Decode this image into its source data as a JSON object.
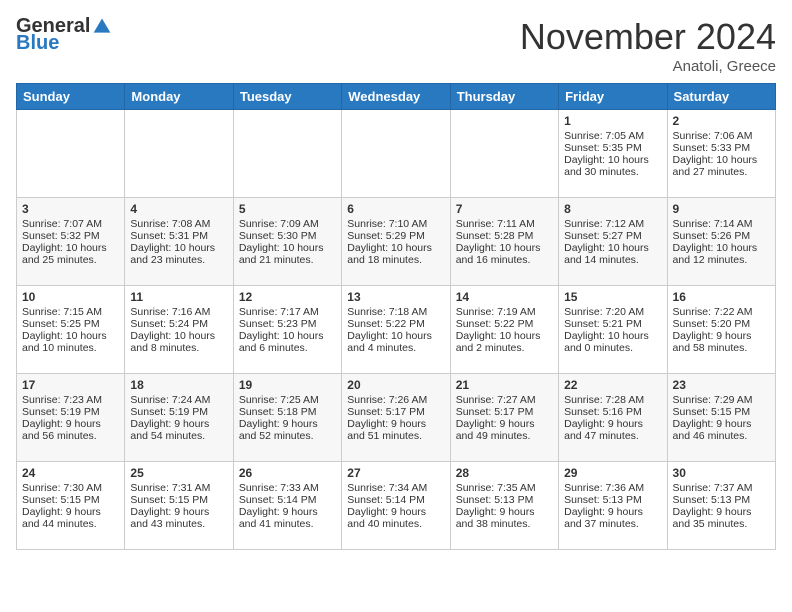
{
  "header": {
    "logo_general": "General",
    "logo_blue": "Blue",
    "month_title": "November 2024",
    "location": "Anatoli, Greece"
  },
  "weekdays": [
    "Sunday",
    "Monday",
    "Tuesday",
    "Wednesday",
    "Thursday",
    "Friday",
    "Saturday"
  ],
  "weeks": [
    [
      {
        "day": "",
        "sunrise": "",
        "sunset": "",
        "daylight": ""
      },
      {
        "day": "",
        "sunrise": "",
        "sunset": "",
        "daylight": ""
      },
      {
        "day": "",
        "sunrise": "",
        "sunset": "",
        "daylight": ""
      },
      {
        "day": "",
        "sunrise": "",
        "sunset": "",
        "daylight": ""
      },
      {
        "day": "",
        "sunrise": "",
        "sunset": "",
        "daylight": ""
      },
      {
        "day": "1",
        "sunrise": "Sunrise: 7:05 AM",
        "sunset": "Sunset: 5:35 PM",
        "daylight": "Daylight: 10 hours and 30 minutes."
      },
      {
        "day": "2",
        "sunrise": "Sunrise: 7:06 AM",
        "sunset": "Sunset: 5:33 PM",
        "daylight": "Daylight: 10 hours and 27 minutes."
      }
    ],
    [
      {
        "day": "3",
        "sunrise": "Sunrise: 7:07 AM",
        "sunset": "Sunset: 5:32 PM",
        "daylight": "Daylight: 10 hours and 25 minutes."
      },
      {
        "day": "4",
        "sunrise": "Sunrise: 7:08 AM",
        "sunset": "Sunset: 5:31 PM",
        "daylight": "Daylight: 10 hours and 23 minutes."
      },
      {
        "day": "5",
        "sunrise": "Sunrise: 7:09 AM",
        "sunset": "Sunset: 5:30 PM",
        "daylight": "Daylight: 10 hours and 21 minutes."
      },
      {
        "day": "6",
        "sunrise": "Sunrise: 7:10 AM",
        "sunset": "Sunset: 5:29 PM",
        "daylight": "Daylight: 10 hours and 18 minutes."
      },
      {
        "day": "7",
        "sunrise": "Sunrise: 7:11 AM",
        "sunset": "Sunset: 5:28 PM",
        "daylight": "Daylight: 10 hours and 16 minutes."
      },
      {
        "day": "8",
        "sunrise": "Sunrise: 7:12 AM",
        "sunset": "Sunset: 5:27 PM",
        "daylight": "Daylight: 10 hours and 14 minutes."
      },
      {
        "day": "9",
        "sunrise": "Sunrise: 7:14 AM",
        "sunset": "Sunset: 5:26 PM",
        "daylight": "Daylight: 10 hours and 12 minutes."
      }
    ],
    [
      {
        "day": "10",
        "sunrise": "Sunrise: 7:15 AM",
        "sunset": "Sunset: 5:25 PM",
        "daylight": "Daylight: 10 hours and 10 minutes."
      },
      {
        "day": "11",
        "sunrise": "Sunrise: 7:16 AM",
        "sunset": "Sunset: 5:24 PM",
        "daylight": "Daylight: 10 hours and 8 minutes."
      },
      {
        "day": "12",
        "sunrise": "Sunrise: 7:17 AM",
        "sunset": "Sunset: 5:23 PM",
        "daylight": "Daylight: 10 hours and 6 minutes."
      },
      {
        "day": "13",
        "sunrise": "Sunrise: 7:18 AM",
        "sunset": "Sunset: 5:22 PM",
        "daylight": "Daylight: 10 hours and 4 minutes."
      },
      {
        "day": "14",
        "sunrise": "Sunrise: 7:19 AM",
        "sunset": "Sunset: 5:22 PM",
        "daylight": "Daylight: 10 hours and 2 minutes."
      },
      {
        "day": "15",
        "sunrise": "Sunrise: 7:20 AM",
        "sunset": "Sunset: 5:21 PM",
        "daylight": "Daylight: 10 hours and 0 minutes."
      },
      {
        "day": "16",
        "sunrise": "Sunrise: 7:22 AM",
        "sunset": "Sunset: 5:20 PM",
        "daylight": "Daylight: 9 hours and 58 minutes."
      }
    ],
    [
      {
        "day": "17",
        "sunrise": "Sunrise: 7:23 AM",
        "sunset": "Sunset: 5:19 PM",
        "daylight": "Daylight: 9 hours and 56 minutes."
      },
      {
        "day": "18",
        "sunrise": "Sunrise: 7:24 AM",
        "sunset": "Sunset: 5:19 PM",
        "daylight": "Daylight: 9 hours and 54 minutes."
      },
      {
        "day": "19",
        "sunrise": "Sunrise: 7:25 AM",
        "sunset": "Sunset: 5:18 PM",
        "daylight": "Daylight: 9 hours and 52 minutes."
      },
      {
        "day": "20",
        "sunrise": "Sunrise: 7:26 AM",
        "sunset": "Sunset: 5:17 PM",
        "daylight": "Daylight: 9 hours and 51 minutes."
      },
      {
        "day": "21",
        "sunrise": "Sunrise: 7:27 AM",
        "sunset": "Sunset: 5:17 PM",
        "daylight": "Daylight: 9 hours and 49 minutes."
      },
      {
        "day": "22",
        "sunrise": "Sunrise: 7:28 AM",
        "sunset": "Sunset: 5:16 PM",
        "daylight": "Daylight: 9 hours and 47 minutes."
      },
      {
        "day": "23",
        "sunrise": "Sunrise: 7:29 AM",
        "sunset": "Sunset: 5:15 PM",
        "daylight": "Daylight: 9 hours and 46 minutes."
      }
    ],
    [
      {
        "day": "24",
        "sunrise": "Sunrise: 7:30 AM",
        "sunset": "Sunset: 5:15 PM",
        "daylight": "Daylight: 9 hours and 44 minutes."
      },
      {
        "day": "25",
        "sunrise": "Sunrise: 7:31 AM",
        "sunset": "Sunset: 5:15 PM",
        "daylight": "Daylight: 9 hours and 43 minutes."
      },
      {
        "day": "26",
        "sunrise": "Sunrise: 7:33 AM",
        "sunset": "Sunset: 5:14 PM",
        "daylight": "Daylight: 9 hours and 41 minutes."
      },
      {
        "day": "27",
        "sunrise": "Sunrise: 7:34 AM",
        "sunset": "Sunset: 5:14 PM",
        "daylight": "Daylight: 9 hours and 40 minutes."
      },
      {
        "day": "28",
        "sunrise": "Sunrise: 7:35 AM",
        "sunset": "Sunset: 5:13 PM",
        "daylight": "Daylight: 9 hours and 38 minutes."
      },
      {
        "day": "29",
        "sunrise": "Sunrise: 7:36 AM",
        "sunset": "Sunset: 5:13 PM",
        "daylight": "Daylight: 9 hours and 37 minutes."
      },
      {
        "day": "30",
        "sunrise": "Sunrise: 7:37 AM",
        "sunset": "Sunset: 5:13 PM",
        "daylight": "Daylight: 9 hours and 35 minutes."
      }
    ]
  ]
}
